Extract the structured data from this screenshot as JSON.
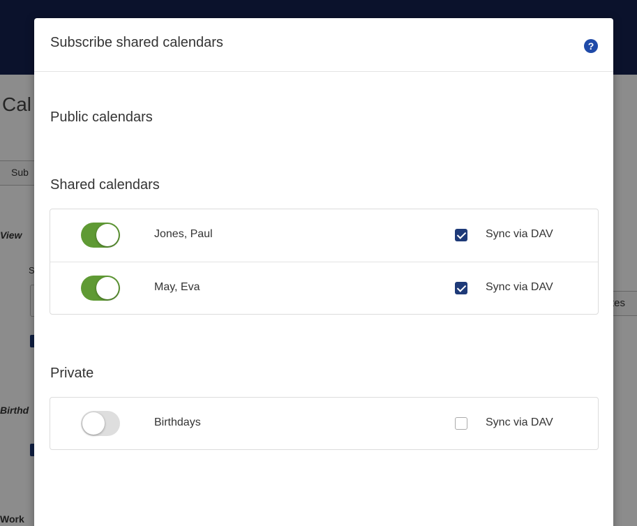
{
  "background": {
    "title": "Cal",
    "subscribe_button": "Sub",
    "view_label": "View",
    "s_label": "S",
    "birthdays_label": "Birthd",
    "work_label": "Work",
    "right_button": "tes"
  },
  "modal": {
    "title": "Subscribe shared calendars",
    "help_icon": "?",
    "sections": {
      "public": {
        "title": "Public calendars"
      },
      "shared": {
        "title": "Shared calendars",
        "items": [
          {
            "name": "Jones, Paul",
            "enabled": true,
            "sync_checked": true,
            "sync_label": "Sync via DAV"
          },
          {
            "name": "May, Eva",
            "enabled": true,
            "sync_checked": true,
            "sync_label": "Sync via DAV"
          }
        ]
      },
      "private": {
        "title": "Private",
        "items": [
          {
            "name": "Birthdays",
            "enabled": false,
            "sync_checked": false,
            "sync_label": "Sync via DAV"
          }
        ]
      }
    }
  },
  "colors": {
    "header": "#152250",
    "toggle_on": "#5f9a34",
    "toggle_off": "#dedede",
    "checkbox_checked": "#1e3a78",
    "help_icon": "#1f4aa8"
  }
}
